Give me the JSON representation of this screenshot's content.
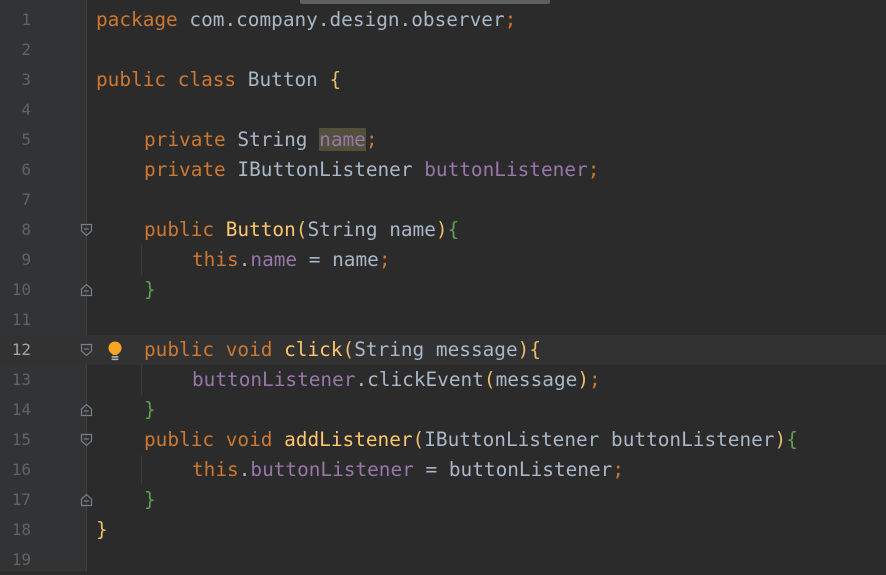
{
  "editor": {
    "language": "Java",
    "current_line": 12,
    "lines": [
      {
        "num": "1"
      },
      {
        "num": "2"
      },
      {
        "num": "3"
      },
      {
        "num": "4"
      },
      {
        "num": "5"
      },
      {
        "num": "6"
      },
      {
        "num": "7"
      },
      {
        "num": "8"
      },
      {
        "num": "9"
      },
      {
        "num": "10"
      },
      {
        "num": "11"
      },
      {
        "num": "12"
      },
      {
        "num": "13"
      },
      {
        "num": "14"
      },
      {
        "num": "15"
      },
      {
        "num": "16"
      },
      {
        "num": "17"
      },
      {
        "num": "18"
      },
      {
        "num": "19"
      }
    ],
    "tokens": {
      "package_kw": "package",
      "package_name": "com.company.design.observer",
      "semicolon": ";",
      "public_kw": "public",
      "class_kw": "class",
      "class_name": "Button",
      "open_brace": "{",
      "close_brace": "}",
      "private_kw": "private",
      "string_type": "String",
      "name_field": "name",
      "listener_type": "IButtonListener",
      "listener_field": "buttonListener",
      "open_paren": "(",
      "close_paren": ")",
      "name_param": "name",
      "this_kw": "this",
      "dot": ".",
      "assign": " = ",
      "void_kw": "void",
      "click_method": "click",
      "message_param": "message",
      "click_event_call": "clickEvent",
      "add_listener_method": "addListener"
    }
  },
  "colors": {
    "background": "#2b2b2b",
    "gutter": "#313335",
    "keyword": "#cc7832",
    "field": "#9876aa",
    "method": "#ffc66d",
    "text": "#a9b7c6",
    "line_number": "#606366",
    "current_line": "#323232",
    "intention_bulb": "#f5a623"
  },
  "icons": {
    "fold_start": "fold-start-icon",
    "fold_end": "fold-end-icon",
    "intention": "lightbulb-icon"
  }
}
